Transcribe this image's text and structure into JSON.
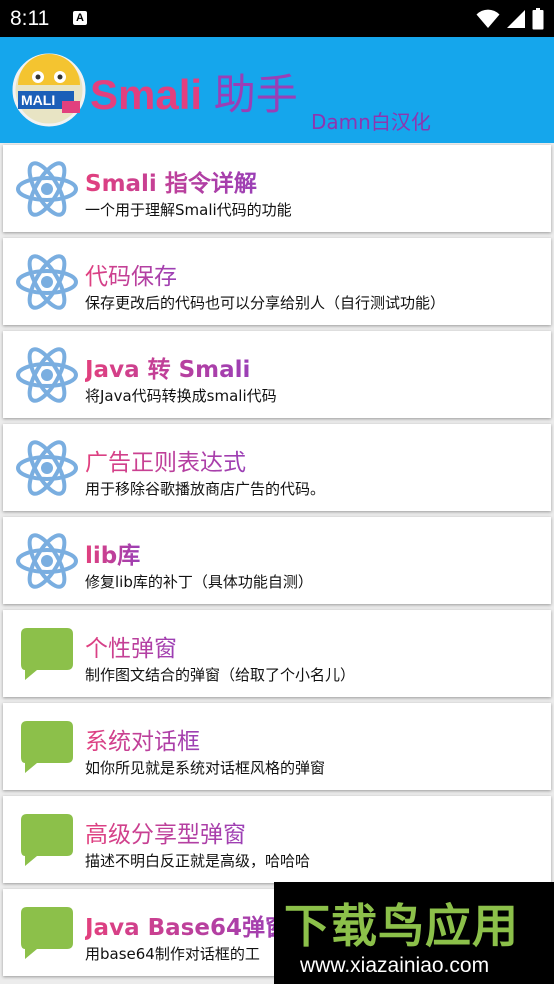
{
  "status_bar": {
    "time": "8:11",
    "notif_letter": "A"
  },
  "header": {
    "title_part1": "Smali",
    "title_part2": "助手",
    "subtitle": "Damn白汉化",
    "logo_text": "MALI"
  },
  "items": [
    {
      "title": "Smali 指令详解",
      "desc": "一个用于理解Smali代码的功能",
      "icon": "atom-icon"
    },
    {
      "title": "代码保存",
      "desc": "保存更改后的代码也可以分享给别人（自行测试功能）",
      "icon": "atom-icon"
    },
    {
      "title": "Java 转 Smali",
      "desc": "将Java代码转换成smali代码",
      "icon": "atom-icon"
    },
    {
      "title": "广告正则表达式",
      "desc": "用于移除谷歌播放商店广告的代码。",
      "icon": "atom-icon"
    },
    {
      "title": "lib库",
      "desc": "修复lib库的补丁（具体功能自测）",
      "icon": "atom-icon"
    },
    {
      "title": "个性弹窗",
      "desc": "制作图文结合的弹窗（给取了个小名儿）",
      "icon": "chat-bubble-icon"
    },
    {
      "title": "系统对话框",
      "desc": "如你所见就是系统对话框风格的弹窗",
      "icon": "chat-bubble-icon"
    },
    {
      "title": "高级分享型弹窗",
      "desc": "描述不明白反正就是高级，哈哈哈",
      "icon": "chat-bubble-icon"
    },
    {
      "title": "Java Base64弹窗",
      "desc": "用base64制作对话框的工",
      "icon": "chat-bubble-icon"
    }
  ],
  "watermark": {
    "main": "下载鸟应用",
    "url": "www.xiazainiao.com"
  },
  "colors": {
    "header_bg": "#15a6ec",
    "title_pink": "#e2407e",
    "title_purple": "#9a3fb6",
    "bubble_green": "#8cc04a",
    "atom_blue": "#7aaee0"
  }
}
